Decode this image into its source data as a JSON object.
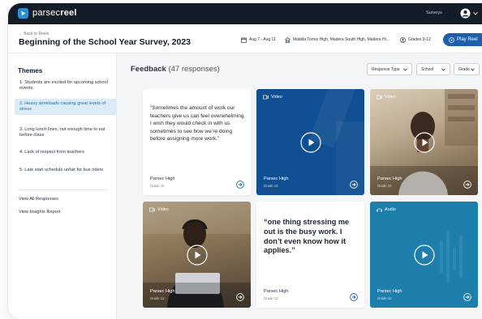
{
  "brand": {
    "name_light": "parsec",
    "name_bold": "reel"
  },
  "nav": {
    "surveys_label": "Surveys"
  },
  "header": {
    "back_label": "← Back to Reels",
    "title": "Beginning of the School Year Survey, 2023",
    "date_range": "Aug 7 - Aug 11",
    "schools": "Matilda Torres High, Madera South High, Madera Hi...",
    "grades": "Grades 9-12",
    "play_reel_label": "Play Reel"
  },
  "sidebar": {
    "title": "Themes",
    "themes": [
      "1. Students are excited for upcoming school events.",
      "2. Heavy workloads causing great levels of stress",
      "3. Long lunch lines, not enough time to eat before class",
      "4. Lack of respect from teachers",
      "5. Late start schedule unfair for bus riders"
    ],
    "active_theme_index": 1,
    "links": [
      "View All Responses",
      "View Insights Report"
    ]
  },
  "feedback": {
    "title": "Feedback",
    "count": "(47 responses)",
    "filters": [
      "Response Type",
      "School",
      "Grade"
    ],
    "cards": [
      {
        "kind": "text",
        "quote": "“Sometimes the amount of work our teachers give us can feel overwhelming. I wish they would check in with us sometimes to see how we’re doing before assigning more work.”",
        "school": "Parsec High",
        "grade": "Grade 10"
      },
      {
        "kind": "video",
        "label": "Video",
        "school": "Parsec High",
        "grade": "Grade 10"
      },
      {
        "kind": "video",
        "label": "Video",
        "school": "Parsec High",
        "grade": "Grade 10"
      },
      {
        "kind": "video",
        "label": "Video",
        "school": "Parsec High",
        "grade": "Grade 12"
      },
      {
        "kind": "text",
        "quote": "“one thing stressing me out is the busy work. I don’t even know how it applies.”",
        "school": "Parsec High",
        "grade": "Grade 10"
      },
      {
        "kind": "audio",
        "label": "Audio",
        "school": "Parsec High",
        "grade": "Grade 10"
      }
    ]
  },
  "colors": {
    "nav_bg": "#141d27",
    "accent": "#1d5fa8",
    "active_theme_bg": "#dcecf6",
    "video_blue": "#0f4f92",
    "audio_teal": "#1f7fac"
  }
}
